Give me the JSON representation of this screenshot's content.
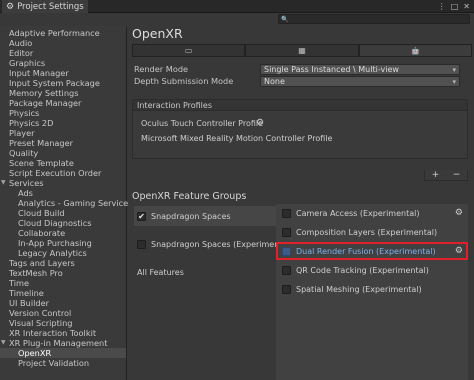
{
  "window": {
    "title": "Project Settings",
    "search_placeholder": ""
  },
  "sidebar": {
    "items": [
      {
        "label": "Adaptive Performance"
      },
      {
        "label": "Audio"
      },
      {
        "label": "Editor"
      },
      {
        "label": "Graphics"
      },
      {
        "label": "Input Manager"
      },
      {
        "label": "Input System Package"
      },
      {
        "label": "Memory Settings"
      },
      {
        "label": "Package Manager"
      },
      {
        "label": "Physics"
      },
      {
        "label": "Physics 2D"
      },
      {
        "label": "Player"
      },
      {
        "label": "Preset Manager"
      },
      {
        "label": "Quality"
      },
      {
        "label": "Scene Template"
      },
      {
        "label": "Script Execution Order"
      },
      {
        "label": "Services"
      },
      {
        "label": "Ads"
      },
      {
        "label": "Analytics - Gaming Services"
      },
      {
        "label": "Cloud Build"
      },
      {
        "label": "Cloud Diagnostics"
      },
      {
        "label": "Collaborate"
      },
      {
        "label": "In-App Purchasing"
      },
      {
        "label": "Legacy Analytics"
      },
      {
        "label": "Tags and Layers"
      },
      {
        "label": "TextMesh Pro"
      },
      {
        "label": "Time"
      },
      {
        "label": "Timeline"
      },
      {
        "label": "UI Builder"
      },
      {
        "label": "Version Control"
      },
      {
        "label": "Visual Scripting"
      },
      {
        "label": "XR Interaction Toolkit"
      },
      {
        "label": "XR Plug-in Management"
      },
      {
        "label": "OpenXR"
      },
      {
        "label": "Project Validation"
      }
    ]
  },
  "main": {
    "title": "OpenXR",
    "render_mode": {
      "label": "Render Mode",
      "value": "Single Pass Instanced \\ Multi-view"
    },
    "depth_mode": {
      "label": "Depth Submission Mode",
      "value": "None"
    },
    "profiles": {
      "header": "Interaction Profiles",
      "items": [
        {
          "label": "Oculus Touch Controller Profile"
        },
        {
          "label": "Microsoft Mixed Reality Motion Controller Profile"
        }
      ]
    },
    "feature_groups_title": "OpenXR Feature Groups",
    "groups": [
      {
        "label": "Snapdragon Spaces",
        "checked": true
      },
      {
        "label": "Snapdragon Spaces (Experimental)",
        "checked": false
      },
      {
        "label": "All Features",
        "checked": false
      }
    ],
    "features": [
      {
        "label": "Camera Access (Experimental)"
      },
      {
        "label": "Composition Layers (Experimental)"
      },
      {
        "label": "Dual Render Fusion (Experimental)"
      },
      {
        "label": "QR Code Tracking (Experimental)"
      },
      {
        "label": "Spatial Meshing (Experimental)"
      }
    ]
  },
  "glyphs": {
    "gear": "⚙",
    "check": "✔",
    "plus": "+",
    "minus": "−",
    "caret": "▾",
    "expanded": "▼",
    "more": "⋮",
    "maximize": "□",
    "close": "✕",
    "search": "🔍",
    "monitor": "▭",
    "grid": "▦",
    "android": "🤖"
  }
}
